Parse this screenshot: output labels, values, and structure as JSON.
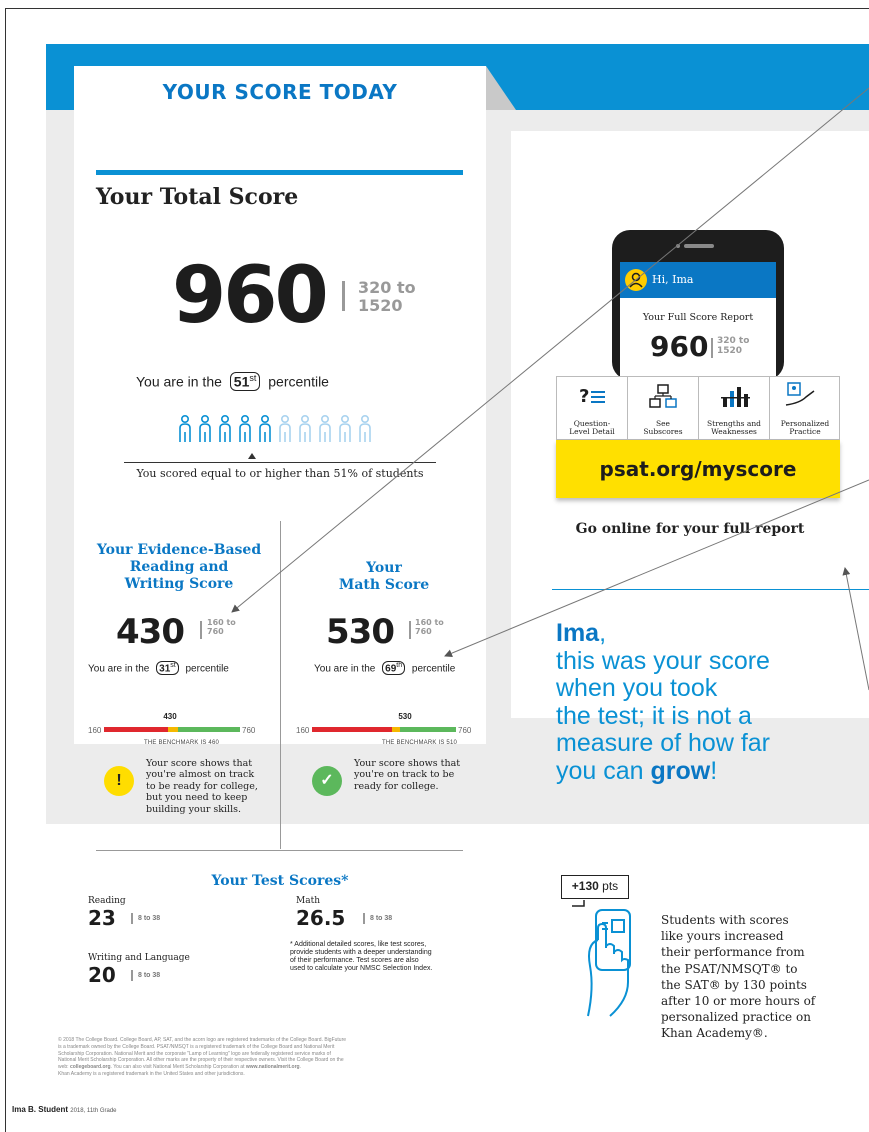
{
  "left": {
    "header": "YOUR SCORE TODAY",
    "total": {
      "title": "Your Total Score",
      "score": "960",
      "range_line1": "320 to",
      "range_line2": "1520",
      "pct_prefix": "You are in the",
      "pct_value": "51",
      "pct_suffix_sup": "st",
      "pct_suffix": "percentile",
      "people_filled": 5,
      "people_total": 10,
      "scored_text": "You scored equal to or higher than 51% of students"
    },
    "ebrw": {
      "title_l1": "Your Evidence-Based",
      "title_l2": "Reading and",
      "title_l3": "Writing Score",
      "score": "430",
      "range_line1": "160 to",
      "range_line2": "760",
      "pct_prefix": "You are in the",
      "pct_value": "31",
      "pct_sup": "st",
      "pct_suffix": "percentile",
      "meter_min": "160",
      "meter_max": "760",
      "meter_mark": "430",
      "benchmark": "THE BENCHMARK IS 460",
      "status_icon": "!",
      "status_l1": "Your score shows that",
      "status_l2": "you're almost on track",
      "status_l3": "to be ready for college,",
      "status_l4": "but you need to keep",
      "status_l5": "building your skills.",
      "status_color": "#ffdd00"
    },
    "math": {
      "title_l1": "Your",
      "title_l2": "Math Score",
      "score": "530",
      "range_line1": "160 to",
      "range_line2": "760",
      "pct_prefix": "You are in the",
      "pct_value": "69",
      "pct_sup": "th",
      "pct_suffix": "percentile",
      "meter_min": "160",
      "meter_max": "760",
      "meter_mark": "530",
      "benchmark": "THE BENCHMARK IS 510",
      "status_icon": "✓",
      "status_l1": "Your score shows that",
      "status_l2": "you're on track to be",
      "status_l3": "ready for college.",
      "status_color": "#5cb85c"
    },
    "tests": {
      "title": "Your Test Scores*",
      "reading_label": "Reading",
      "reading_score": "23",
      "reading_range": "8 to 38",
      "math_label": "Math",
      "math_score": "26.5",
      "math_range": "8 to 38",
      "writing_label": "Writing and Language",
      "writing_score": "20",
      "writing_range": "8 to 38",
      "note_l1": "* Additional detailed scores, like test scores,",
      "note_l2": "provide students with a deeper understanding",
      "note_l3": "of their performance. Test scores are also",
      "note_l4": "used to calculate your NMSC Selection Index."
    },
    "legal_l1": "© 2018 The College Board. College Board, AP, SAT, and the acorn logo are registered trademarks of the College Board. BigFuture",
    "legal_l2": "is a trademark owned by the College Board. PSAT/NMSQT is a registered trademark of the College Board and National Merit",
    "legal_l3": "Scholarship Corporation. National Merit and the corporate \"Lamp of Learning\" logo are federally registered service marks of",
    "legal_l4": "National Merit Scholarship Corporation. All other marks are the property of their respective owners. Visit the College Board on the",
    "legal_l5a": "web: ",
    "legal_l5b": "collegeboard.org",
    "legal_l5c": ". You can also visit National Merit Scholarship Corporation at ",
    "legal_l5d": "www.nationalmerit.org",
    "legal_l5e": ".",
    "legal_l6": "Khan Academy is a registered trademark in the United States and other jurisdictions."
  },
  "right": {
    "phone": {
      "greeting": "Hi, Ima",
      "report_title": "Your Full Score Report",
      "score": "960",
      "range_line1": "320 to",
      "range_line2": "1520"
    },
    "features": [
      {
        "l1": "Question-",
        "l2": "Level Detail"
      },
      {
        "l1": "See",
        "l2": "Subscores"
      },
      {
        "l1": "Strengths and",
        "l2": "Weaknesses"
      },
      {
        "l1": "Personalized",
        "l2": "Practice"
      }
    ],
    "url": "psat.org/myscore",
    "go_online": "Go online for your full report",
    "growth_name": "Ima",
    "growth_comma": ",",
    "growth_l1": "this was your score",
    "growth_l2": "when you took",
    "growth_l3": "the test; it is not a",
    "growth_l4": "measure of how far",
    "growth_l5a": "you can ",
    "growth_l5b": "grow",
    "growth_l5c": "!",
    "pts_value": "+130",
    "pts_unit": "pts",
    "students_l1": "Students with scores",
    "students_l2": "like yours increased",
    "students_l3": "their performance from",
    "students_l4": "the PSAT/NMSQT® to",
    "students_l5": "the SAT® by 130 points",
    "students_l6": "after 10 or more hours of",
    "students_l7": "personalized practice on",
    "students_l8": "Khan Academy®."
  },
  "footer": {
    "student": "Ima B. Student",
    "meta": "2018, 11th Grade"
  },
  "colors": {
    "brand_blue": "#0a91d4",
    "title_blue": "#0a77c4",
    "highlight_yellow": "#ffe000",
    "meter_red": "#e0282e",
    "meter_yellow": "#f5b800",
    "meter_green": "#5cb85c"
  }
}
